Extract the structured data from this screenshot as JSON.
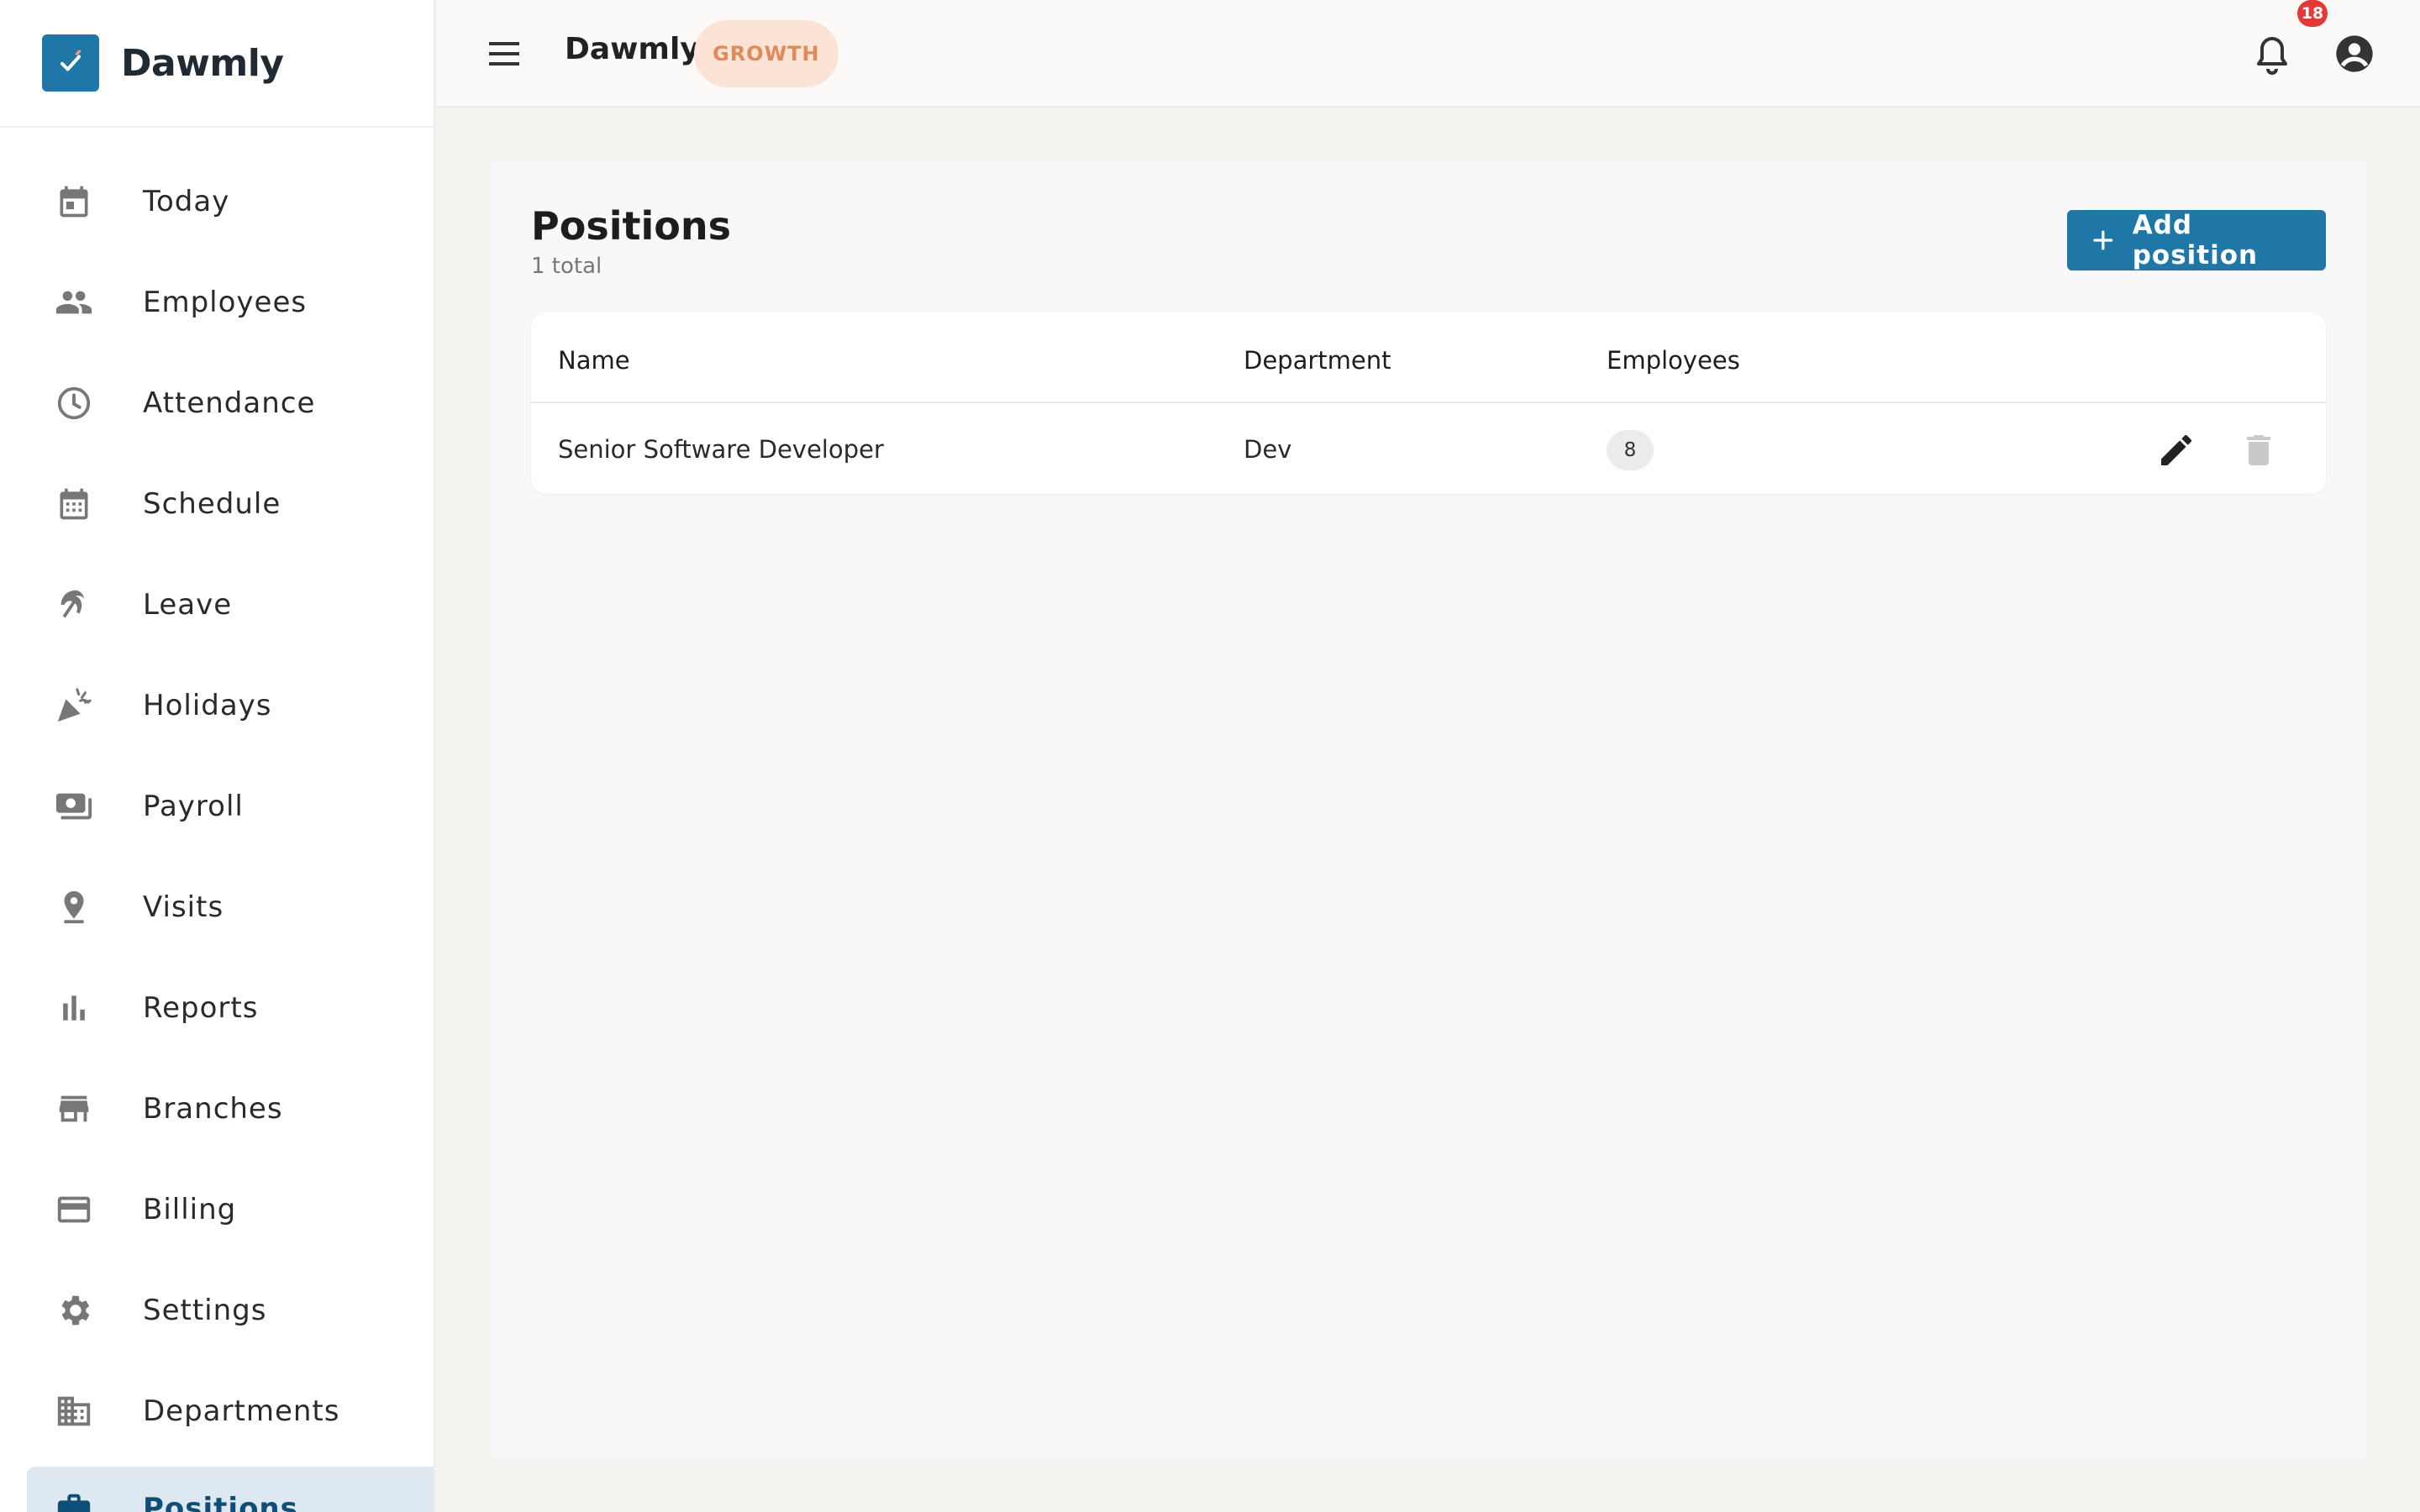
{
  "brand": {
    "name": "Dawmly"
  },
  "sidebar": {
    "items": [
      {
        "label": "Today",
        "icon": "calendar-today-icon"
      },
      {
        "label": "Employees",
        "icon": "people-icon"
      },
      {
        "label": "Attendance",
        "icon": "clock-icon"
      },
      {
        "label": "Schedule",
        "icon": "calendar-grid-icon"
      },
      {
        "label": "Leave",
        "icon": "beach-umbrella-icon"
      },
      {
        "label": "Holidays",
        "icon": "party-popper-icon"
      },
      {
        "label": "Payroll",
        "icon": "money-icon"
      },
      {
        "label": "Visits",
        "icon": "map-pin-icon"
      },
      {
        "label": "Reports",
        "icon": "bar-chart-icon"
      },
      {
        "label": "Branches",
        "icon": "store-icon"
      },
      {
        "label": "Billing",
        "icon": "credit-card-icon"
      },
      {
        "label": "Settings",
        "icon": "gear-icon"
      },
      {
        "label": "Departments",
        "icon": "building-icon"
      },
      {
        "label": "Positions",
        "icon": "briefcase-icon",
        "active": true
      }
    ]
  },
  "topbar": {
    "title": "Dawmly",
    "plan_badge": "GROWTH",
    "notification_count": "18"
  },
  "main": {
    "title": "Positions",
    "subtitle": "1 total",
    "add_button_label": "Add position",
    "table": {
      "headers": [
        "Name",
        "Department",
        "Employees"
      ],
      "rows": [
        {
          "name": "Senior Software Developer",
          "department": "Dev",
          "employees": "8"
        }
      ]
    }
  },
  "colors": {
    "accent": "#1e77a6",
    "badge_bg": "#fbe3d6",
    "badge_text": "#e08a5a",
    "notification": "#e53935",
    "active_nav_bg": "#dde8f0"
  }
}
